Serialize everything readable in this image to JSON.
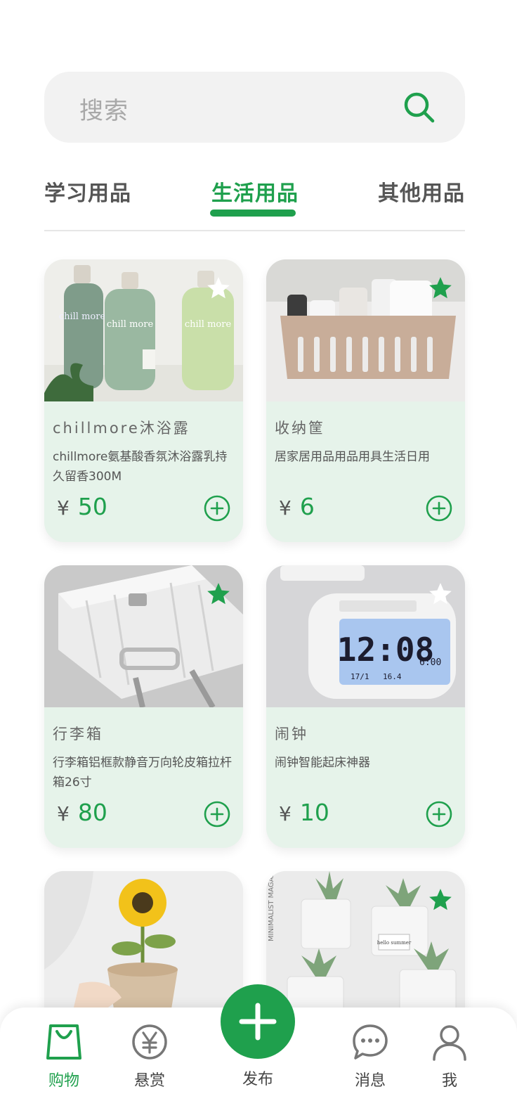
{
  "search": {
    "placeholder": "搜索"
  },
  "tabs": [
    {
      "label": "学习用品",
      "active": false
    },
    {
      "label": "生活用品",
      "active": true
    },
    {
      "label": "其他用品",
      "active": false
    }
  ],
  "accent_color": "#1fa04d",
  "products": [
    {
      "title": "chillmore沐浴露",
      "desc": "chillmore氨基酸香氛沐浴露乳持久留香300M",
      "currency": "¥",
      "price": "50",
      "favorited": false
    },
    {
      "title": "收纳筐",
      "desc": "居家居用品用品用具生活日用",
      "currency": "¥",
      "price": "6",
      "favorited": true
    },
    {
      "title": "行李箱",
      "desc": "行李箱铝框款静音万向轮皮箱拉杆箱26寸",
      "currency": "¥",
      "price": "80",
      "favorited": true
    },
    {
      "title": "闹钟",
      "desc": "闹钟智能起床神器",
      "currency": "¥",
      "price": "10",
      "favorited": false
    },
    {
      "title": "",
      "desc": "",
      "currency": "",
      "price": "",
      "favorited": false
    },
    {
      "title": "",
      "desc": "",
      "currency": "",
      "price": "",
      "favorited": true
    }
  ],
  "images": {
    "bottle_text": "chill more",
    "clock_time": "12:08",
    "clock_date": "17/1",
    "clock_temp": "16.4",
    "clock_alarm": "6:00",
    "plant_tag": "hello summer",
    "magazine": "MINIMALIST MAGAZINE"
  },
  "bottom_nav": [
    {
      "label": "购物",
      "icon": "shopping-bag-icon",
      "active": true
    },
    {
      "label": "悬赏",
      "icon": "yuan-coin-icon",
      "active": false
    },
    {
      "label": "发布",
      "icon": "plus-icon",
      "active": false
    },
    {
      "label": "消息",
      "icon": "chat-bubble-icon",
      "active": false
    },
    {
      "label": "我",
      "icon": "user-icon",
      "active": false
    }
  ]
}
